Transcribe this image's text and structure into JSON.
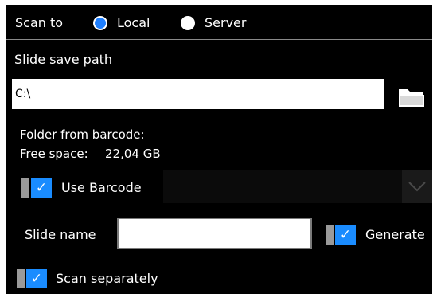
{
  "scan_to": {
    "label": "Scan to",
    "options": [
      {
        "label": "Local",
        "selected": true
      },
      {
        "label": "Server",
        "selected": false
      }
    ]
  },
  "slide_save_path": {
    "label": "Slide save path",
    "value": "C:\\"
  },
  "info": {
    "folder_from_barcode": "Folder from barcode:",
    "free_space_label": "Free space:",
    "free_space_value": "22,04 GB"
  },
  "use_barcode": {
    "label": "Use Barcode",
    "checked": true,
    "check_glyph": "✓"
  },
  "slide_name": {
    "label": "Slide name",
    "value": ""
  },
  "generate": {
    "label": "Generate",
    "checked": true,
    "check_glyph": "✓"
  },
  "scan_separately": {
    "label": "Scan separately",
    "checked": true,
    "check_glyph": "✓"
  },
  "colors": {
    "accent": "#1a8cff",
    "background": "#000000"
  },
  "icons": {
    "folder": "folder-icon",
    "dropdown": "chevron-down-icon"
  }
}
